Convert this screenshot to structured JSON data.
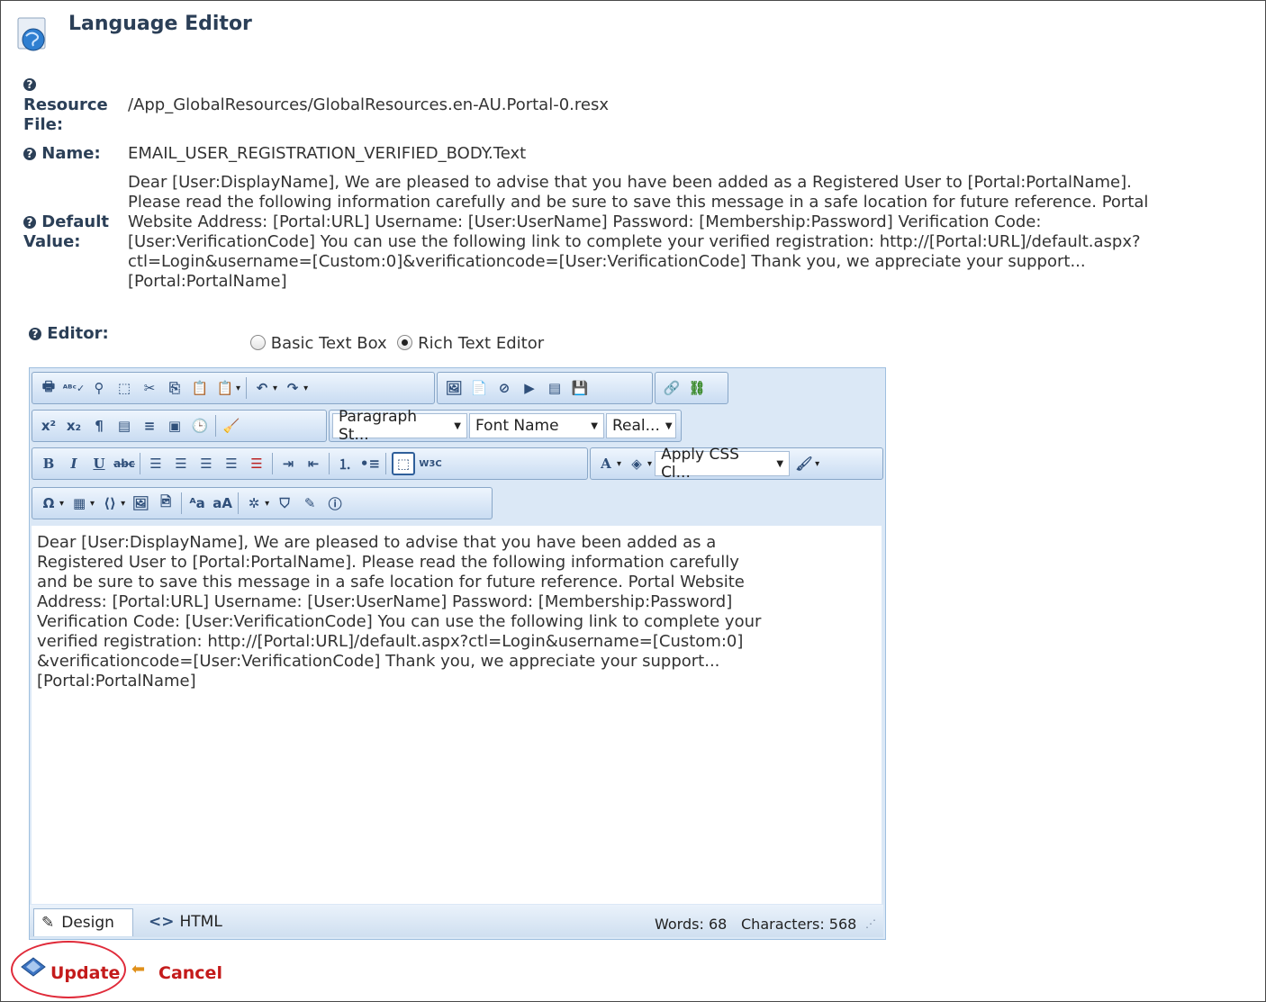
{
  "page": {
    "title": "Language Editor"
  },
  "properties": {
    "resource_file": {
      "label_line1": "Resource",
      "label_line2": "File:",
      "value": "/App_GlobalResources/GlobalResources.en-AU.Portal-0.resx"
    },
    "name": {
      "label": "Name:",
      "value": "EMAIL_USER_REGISTRATION_VERIFIED_BODY.Text"
    },
    "default_value": {
      "label_line1": "Default",
      "label_line2": "Value:",
      "lines": [
        "Dear [User:DisplayName], We are pleased to advise that you have been added as a Registered User to [Portal:PortalName].",
        "Please read the following information carefully and be sure to save this message in a safe location for future reference. Portal",
        "Website Address: [Portal:URL] Username: [User:UserName] Password: [Membership:Password] Verification Code:",
        "[User:VerificationCode] You can use the following link to complete your verified registration: http://[Portal:URL]/default.aspx?",
        "ctl=Login&username=[Custom:0]&verificationcode=[User:VerificationCode] Thank you, we appreciate your support...",
        "[Portal:PortalName]"
      ]
    },
    "editor": {
      "label": "Editor:"
    }
  },
  "editor_mode": {
    "options": [
      "Basic Text Box",
      "Rich Text Editor"
    ],
    "selected": "Rich Text Editor"
  },
  "toolbar": {
    "paragraph_style": "Paragraph St...",
    "font_name": "Font Name",
    "font_size": "Real...",
    "css_class": "Apply CSS Cl..."
  },
  "content": {
    "lines": [
      "Dear [User:DisplayName], We are pleased to advise that you have been added as a",
      "Registered User to [Portal:PortalName]. Please read the following information carefully",
      "and be sure to save this message in a safe location for future reference. Portal Website",
      "Address: [Portal:URL] Username: [User:UserName] Password: [Membership:Password]",
      "Verification Code: [User:VerificationCode] You can use the following link to complete your",
      "verified registration: http://[Portal:URL]/default.aspx?ctl=Login&username=[Custom:0]",
      "&verificationcode=[User:VerificationCode] Thank you, we appreciate your support...",
      "[Portal:PortalName]"
    ]
  },
  "status": {
    "design_tab": "Design",
    "html_tab": "HTML",
    "words": "Words: 68",
    "characters": "Characters: 568"
  },
  "actions": {
    "update": "Update",
    "cancel": "Cancel"
  },
  "colors": {
    "heading": "#2b3f57",
    "action": "#c41b1b",
    "highlight_circle": "#e02b3a"
  }
}
